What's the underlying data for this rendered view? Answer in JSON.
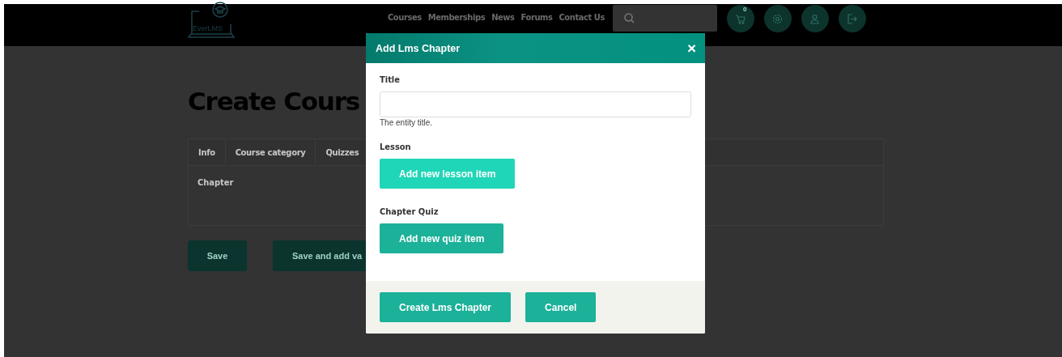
{
  "header": {
    "logo_text": "EverLMS",
    "nav": [
      {
        "label": "Courses"
      },
      {
        "label": "Memberships"
      },
      {
        "label": "News"
      },
      {
        "label": "Forums"
      },
      {
        "label": "Contact Us"
      }
    ],
    "cart_count": "0"
  },
  "page": {
    "heading": "Create Cours",
    "tabs": [
      {
        "label": "Info"
      },
      {
        "label": "Course category"
      },
      {
        "label": "Quizzes"
      }
    ],
    "section_label": "Chapter",
    "buttons": [
      "Save",
      "Save and add va"
    ]
  },
  "modal": {
    "title": "Add Lms Chapter",
    "close": "×",
    "fields": [
      {
        "kind": "text",
        "label": "Title",
        "help": "The entity title."
      },
      {
        "kind": "button",
        "label": "Lesson",
        "button": "Add new lesson item",
        "highlight": true
      },
      {
        "kind": "button",
        "label": "Chapter Quiz",
        "button": "Add new quiz item",
        "highlight": false
      }
    ],
    "actions": [
      "Create Lms Chapter",
      "Cancel"
    ]
  }
}
